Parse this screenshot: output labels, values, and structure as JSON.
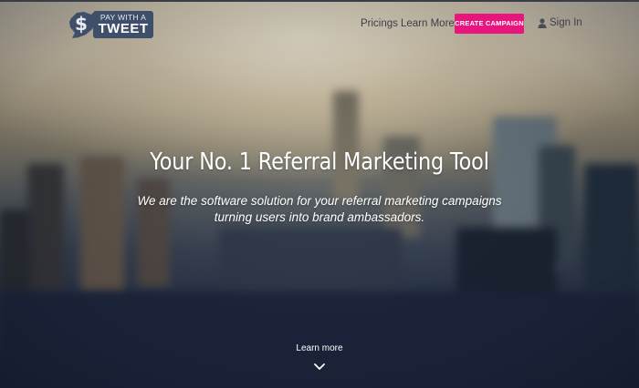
{
  "logo": {
    "line1": "PAY WITH A",
    "line2": "TWEET",
    "mark": "dollar-bird-icon"
  },
  "nav": {
    "links": [
      "Pricings",
      "Learn More"
    ],
    "cta_label": "CREATE CAMPAIGN",
    "signin_label": "Sign In",
    "signin_icon": "user-icon"
  },
  "hero": {
    "headline": "Your No. 1 Referral Marketing Tool",
    "subtitle": "We are the software solution for your referral marketing campaigns turning users into brand ambassadors.",
    "learn_more": "Learn more",
    "learn_more_icon": "chevron-down-icon"
  },
  "colors": {
    "cta": "#e8157f",
    "logo_box": "#3f4f6a",
    "nav_text": "#3c3f47"
  }
}
